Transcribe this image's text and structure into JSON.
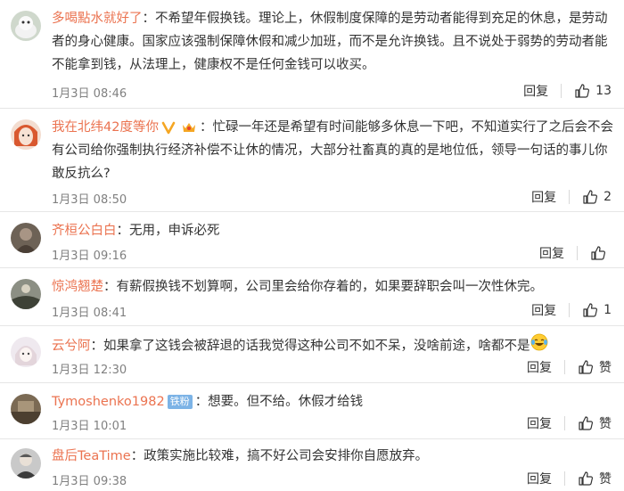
{
  "comments": [
    {
      "username": "多喝點水就好了",
      "text": "：不希望年假换钱。理论上，休假制度保障的是劳动者能得到充足的休息，是劳动者的身心健康。国家应该强制保障休假和减少加班，而不是允许换钱。且不说处于弱势的劳动者能不能拿到钱，从法理上，健康权不是任何金钱可以收买。",
      "time": "1月3日 08:46",
      "reply": "回复",
      "likes": "13"
    },
    {
      "username": "我在北纬42度等你",
      "text": "：忙碌一年还是希望有时间能够多休息一下吧，不知道实行了之后会不会有公司给你强制执行经济补偿不让休的情况，大部分社畜真的真的是地位低，领导一句话的事儿你敢反抗么?",
      "time": "1月3日 08:50",
      "reply": "回复",
      "likes": "2",
      "badge_icons": [
        "vip-v-icon",
        "crown-badge-icon"
      ],
      "badge_color": "#f5a623"
    },
    {
      "username": "齐桓公白白",
      "text": "：无用，申诉必死",
      "time": "1月3日 09:16",
      "reply": "回复",
      "likes": ""
    },
    {
      "username": "惊鸿翘楚",
      "text": "：有薪假换钱不划算啊，公司里会给你存着的，如果要辞职会叫一次性休完。",
      "time": "1月3日 08:41",
      "reply": "回复",
      "likes": "1"
    },
    {
      "username": "云兮阿",
      "text": "：如果拿了这钱会被辞退的话我觉得这种公司不如不呆，没啥前途，啥都不是",
      "time": "1月3日 12:30",
      "reply": "回复",
      "likes": "赞",
      "emoji": "laughing-tears-emoji"
    },
    {
      "username": "Tymoshenko1982",
      "fan_badge": "铁粉",
      "text": "：想要。但不给。休假才给钱",
      "time": "1月3日 10:01",
      "reply": "回复",
      "likes": "赞"
    },
    {
      "username": "盘后TeaTime",
      "text": "：政策实施比较难，搞不好公司会安排你自愿放弃。",
      "time": "1月3日 09:38",
      "reply": "回复",
      "likes": "赞"
    }
  ],
  "colors": {
    "username": "#eb7350",
    "text": "#333333",
    "meta": "#808080",
    "divider": "#e6e6e6",
    "fan_badge_bg": "#7cb3e6"
  }
}
